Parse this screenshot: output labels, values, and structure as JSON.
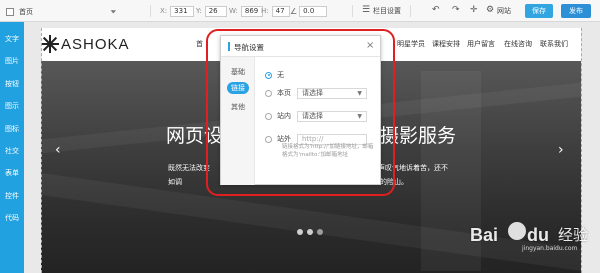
{
  "toolbar": {
    "page_select": "首页",
    "x_label": "X:",
    "x_value": "331",
    "y_label": "Y:",
    "y_value": "26",
    "w_label": "W:",
    "w_value": "869",
    "h_label": "H:",
    "h_value": "47",
    "angle_value": "0.0",
    "column_settings": "栏目设置",
    "site": "网站",
    "save": "保存",
    "publish": "发布"
  },
  "sidebar": {
    "items": [
      "文字",
      "图片",
      "按钮",
      "图示",
      "图标",
      "社交",
      "表单",
      "控件",
      "代码"
    ]
  },
  "site": {
    "logo_text": "ASHOKA",
    "nav": [
      "首",
      "明星学员",
      "课程安排",
      "用户留言",
      "在线咨询",
      "联系我们"
    ]
  },
  "hero": {
    "title_left": "网页设",
    "title_right": "摄影服务",
    "sub_line1_left": "既然无法改变",
    "sub_line1_right": "声叹气地诉着苦，还不",
    "sub_line2_left": "如调",
    "sub_line2_right": "的险山。",
    "prev": "‹",
    "next": "›"
  },
  "dialog": {
    "title": "导航设置",
    "close": "×",
    "tabs": [
      "基础",
      "链接",
      "其他"
    ],
    "active_tab": "链接",
    "options": {
      "none_label": "无",
      "page_label": "本页",
      "page_select": "请选择",
      "site_label": "站内",
      "site_select": "请选择",
      "external_label": "站外",
      "external_placeholder": "http://"
    },
    "hint": "链接格式为'http://'加链接地址，邮箱格式为'mailto:'加邮箱地址"
  },
  "watermark": {
    "bai": "Bai",
    "du": "du",
    "jingyan": "经验",
    "url": "jingyan.baidu.com"
  },
  "colors": {
    "accent": "#2aa2e3",
    "sidebar": "#22a1e0",
    "annotation": "#e02020"
  }
}
